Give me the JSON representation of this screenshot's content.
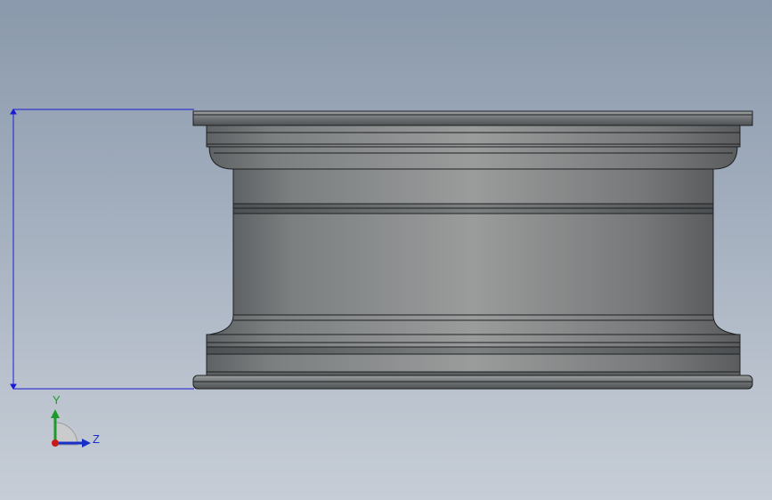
{
  "viewport": {
    "background_top": "#8a99ab",
    "background_bottom": "#c6cdd6"
  },
  "part": {
    "body_color": "#7b7e80",
    "highlight_color": "#a3a6a6",
    "shadow_color": "#55585a",
    "edge_color": "#1e2022"
  },
  "dimension": {
    "line_color": "#1a1ad6",
    "value": ""
  },
  "triad": {
    "y_label": "Y",
    "z_label": "Z",
    "y_color": "#1f9a2a",
    "z_color": "#1a2fc8",
    "x_color": "#c81a1a"
  }
}
